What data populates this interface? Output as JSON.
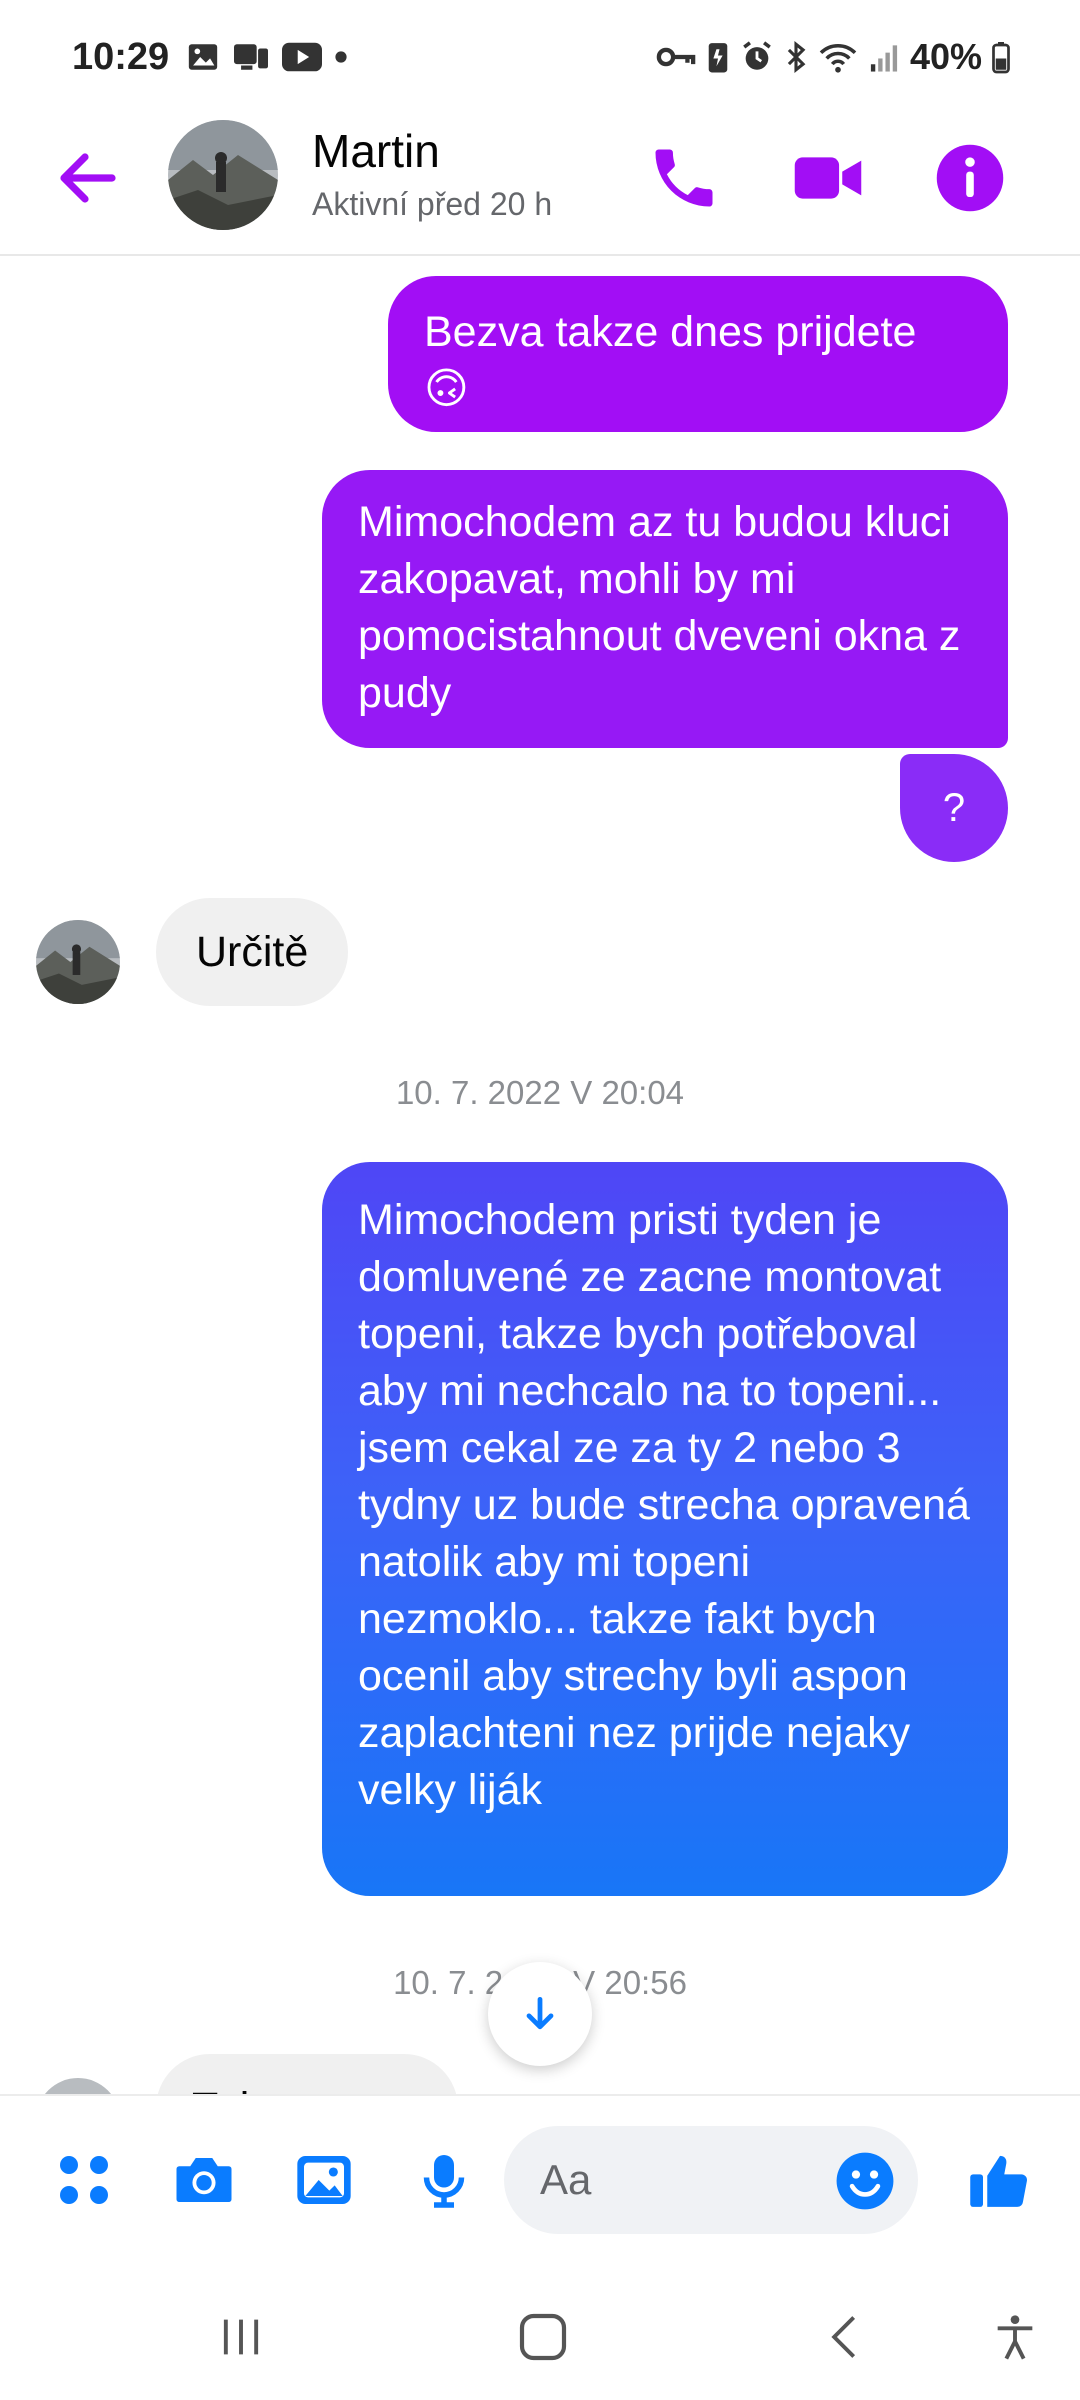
{
  "status_bar": {
    "time": "10:29",
    "battery": "40%"
  },
  "header": {
    "name": "Martin",
    "status": "Aktivní před 20 h"
  },
  "messages": [
    {
      "from": "me",
      "text": "Bezva takze dnes prijdete 🙃"
    },
    {
      "from": "me",
      "text": "Mimochodem az tu budou kluci zakopavat, mohli by mi pomocistahnout dveveni okna z pudy"
    },
    {
      "from": "me",
      "text": "?"
    },
    {
      "from": "them",
      "text": "Určitě"
    },
    {
      "from": "me",
      "text": "Mimochodem pristi tyden je domluvené ze zacne montovat topeni, takze bych potřeboval aby mi nechcalo na to topeni... jsem cekal ze za ty 2 nebo 3 tydny uz bude strecha opravená  natolik aby mi topeni nezmoklo... takze fakt bych ocenil aby strechy byli aspon zaplachteni nez prijde nejaky velky liják"
    },
    {
      "from": "them",
      "text": "Tzj..."
    }
  ],
  "timestamps": [
    "10. 7. 2022 V 20:04",
    "10. 7. 2",
    "V 20:56"
  ],
  "composer": {
    "placeholder": "Aa"
  },
  "colors": {
    "accent": "#a20ef5",
    "messenger_blue": "#0a7cff",
    "received_bg": "#f0f0f0"
  },
  "icons": [
    "back-arrow-icon",
    "phone-icon",
    "video-camera-icon",
    "info-icon",
    "apps-grid-icon",
    "camera-icon",
    "image-icon",
    "microphone-icon",
    "emoji-icon",
    "thumbs-up-icon",
    "arrow-down-icon",
    "recents-icon",
    "home-icon",
    "back-icon",
    "accessibility-icon"
  ]
}
